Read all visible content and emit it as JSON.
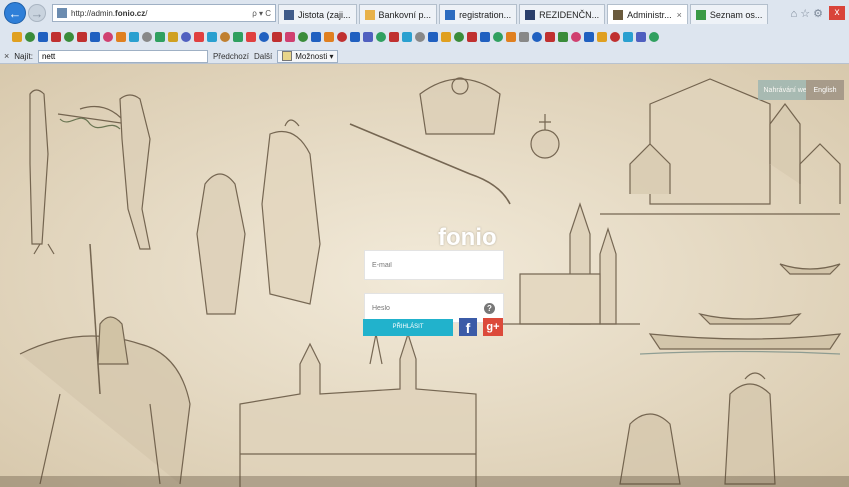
{
  "browser": {
    "address_url_prefix": "http://admin.",
    "address_url_domain": "fonio.cz",
    "address_url_suffix": "/",
    "address_controls": "ρ ▾ C",
    "tabs": [
      {
        "label": "Jistota (zaji...",
        "color": "#3f5b8a",
        "active": false
      },
      {
        "label": "Bankovní p...",
        "color": "#e8b24a",
        "active": false
      },
      {
        "label": "registration...",
        "color": "#2d6cc0",
        "active": false
      },
      {
        "label": "REZIDENČN...",
        "color": "#2b3f6b",
        "active": false
      },
      {
        "label": "Administr...",
        "color": "#6a5a3c",
        "active": true
      },
      {
        "label": "Seznam os...",
        "color": "#3a9a45",
        "active": false
      }
    ],
    "window_controls": "⌂ ☆ ⚙",
    "window_close": "x"
  },
  "findbar": {
    "close_label": "×",
    "label": "Najít:",
    "value": "nett",
    "prev_label": "Předchozí",
    "next_label": "Další",
    "options_label": "Možnosti ▾"
  },
  "favorites_colors": [
    "#e0a020",
    "#3a8c3a",
    "#2060c0",
    "#c03030",
    "#3a8c3a",
    "#c03030",
    "#2060c0",
    "#d04070",
    "#e08020",
    "#2aa0d0",
    "#888888",
    "#30a060",
    "#d0a020",
    "#5060c0",
    "#e04040",
    "#2aa0d0",
    "#c08030",
    "#30a060",
    "#e04040",
    "#2060c0",
    "#c03030",
    "#d04070",
    "#3a8c3a",
    "#2060c0",
    "#e08020",
    "#c03030",
    "#2060c0",
    "#5060c0",
    "#30a060",
    "#c03030",
    "#2aa0d0",
    "#888888",
    "#2060c0",
    "#e0a020",
    "#3a8c3a",
    "#c03030",
    "#2060c0",
    "#30a060",
    "#e08020",
    "#888888",
    "#2060c0",
    "#c03030",
    "#3a8c3a",
    "#d04070",
    "#2060c0",
    "#e0a020",
    "#c03030",
    "#2aa0d0",
    "#5060c0",
    "#30a060"
  ],
  "page": {
    "lang_cz": "Nahrávání webu",
    "lang_en": "English",
    "logo": "fonio",
    "email_placeholder": "E-mail",
    "password_placeholder": "Heslo",
    "help_icon": "?",
    "submit_label": "PŘIHLÁSIT",
    "facebook_label": "f",
    "google_label": "g+",
    "accent_color": "#21b2cc"
  }
}
